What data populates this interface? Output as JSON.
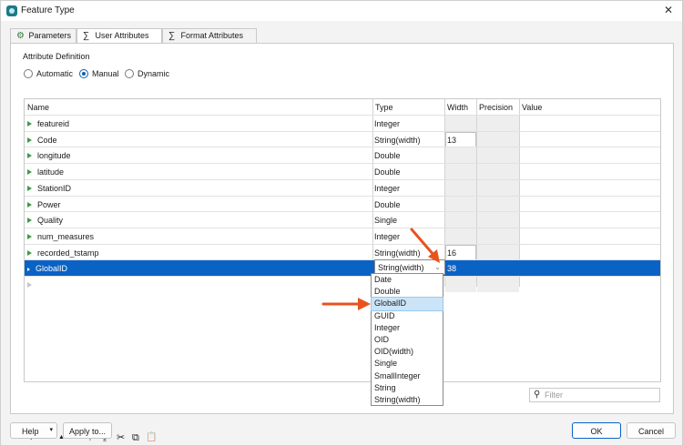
{
  "window": {
    "title": "Feature Type",
    "close_glyph": "✕"
  },
  "tabs": [
    {
      "label": "Parameters",
      "icon": "gear-icon"
    },
    {
      "label": "User Attributes",
      "icon": "sigma-icon"
    },
    {
      "label": "Format Attributes",
      "icon": "sigma-icon"
    }
  ],
  "active_tab": "User Attributes",
  "attribute_definition": {
    "label": "Attribute Definition",
    "options": [
      "Automatic",
      "Manual",
      "Dynamic"
    ],
    "selected": "Manual"
  },
  "grid": {
    "columns": [
      "Name",
      "Type",
      "Width",
      "Precision",
      "Value"
    ],
    "rows": [
      {
        "name": "featureid",
        "type": "Integer",
        "width": ""
      },
      {
        "name": "Code",
        "type": "String(width)",
        "width": "13"
      },
      {
        "name": "longitude",
        "type": "Double",
        "width": ""
      },
      {
        "name": "latitude",
        "type": "Double",
        "width": ""
      },
      {
        "name": "StationID",
        "type": "Integer",
        "width": ""
      },
      {
        "name": "Power",
        "type": "Double",
        "width": ""
      },
      {
        "name": "Quality",
        "type": "Single",
        "width": ""
      },
      {
        "name": "num_measures",
        "type": "Integer",
        "width": ""
      },
      {
        "name": "recorded_tstamp",
        "type": "String(width)",
        "width": "16"
      },
      {
        "name": "GlobalID",
        "type": "String(width)",
        "width": "38",
        "selected": true
      }
    ]
  },
  "type_dropdown": {
    "current": "String(width)",
    "options": [
      "Date",
      "Double",
      "GlobalID",
      "GUID",
      "Integer",
      "OID",
      "OID(width)",
      "Single",
      "SmallInteger",
      "String",
      "String(width)"
    ],
    "highlighted": "GlobalID"
  },
  "toolbar": {
    "add": "+",
    "remove": "−",
    "move_up": "▲",
    "move_down": "▼",
    "move_top": "⤒",
    "move_bottom": "⤓",
    "cut": "✂",
    "copy": "⧉",
    "paste": "📋"
  },
  "filter": {
    "placeholder": "Filter",
    "value": ""
  },
  "footer": {
    "help": "Help",
    "apply": "Apply to...",
    "ok": "OK",
    "cancel": "Cancel"
  },
  "annotation_color": "#e8531e"
}
